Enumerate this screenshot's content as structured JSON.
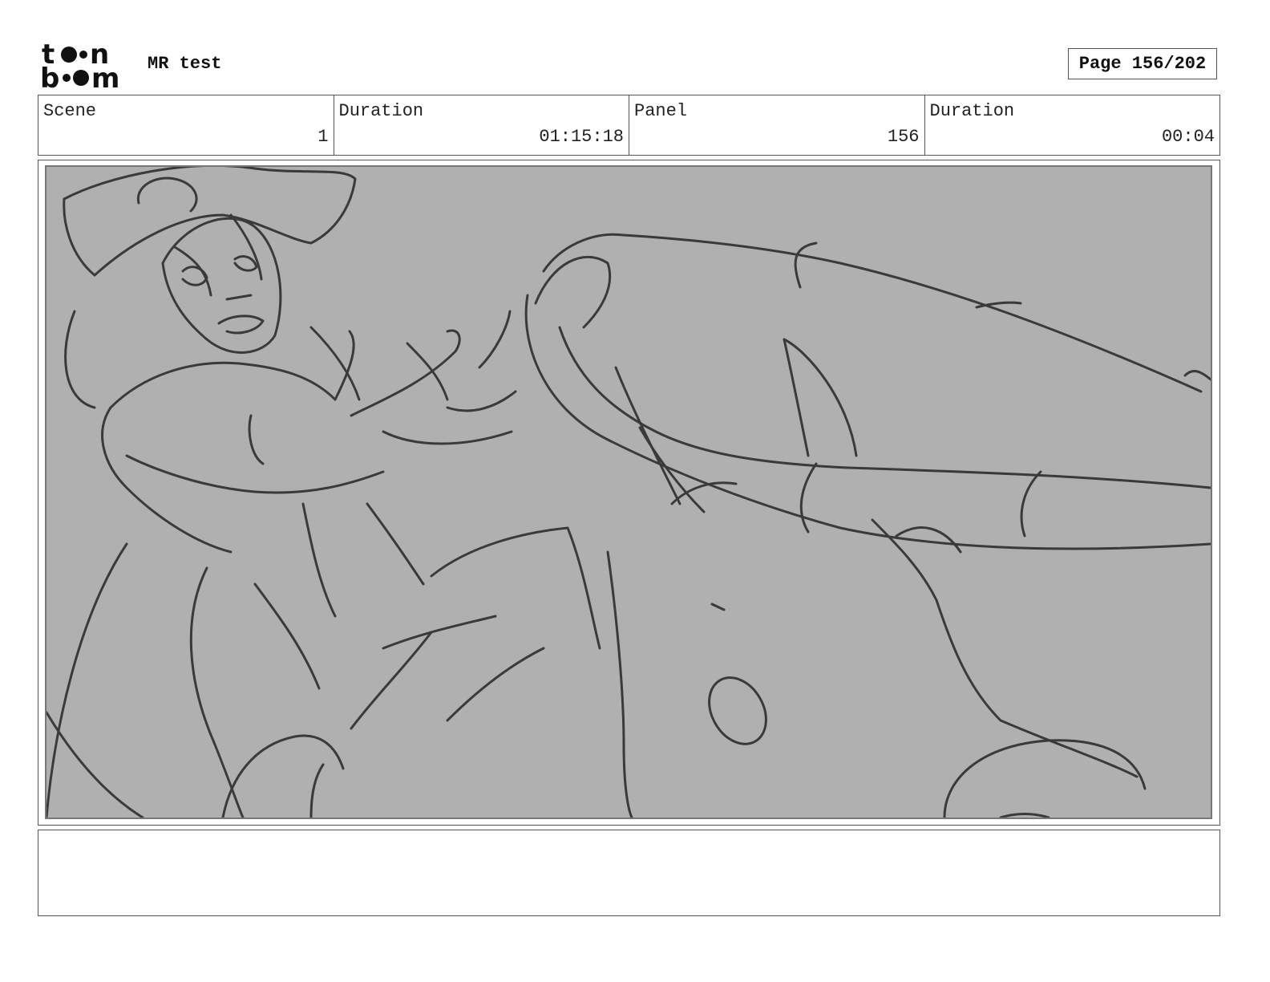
{
  "header": {
    "logo_text": "toon boom",
    "project_title": "MR test",
    "page_indicator": "Page 156/202"
  },
  "info": [
    {
      "label": "Scene",
      "value": "1"
    },
    {
      "label": "Duration",
      "value": "01:15:18"
    },
    {
      "label": "Panel",
      "value": "156"
    },
    {
      "label": "Duration",
      "value": "00:04"
    }
  ],
  "panel": {
    "image_description": "pencil sketch: character in wide-brim hat bracing against a large creature's tentacle",
    "background_color": "#b0b0b0",
    "stroke_color": "#3a3a3a"
  },
  "notes": {
    "text": ""
  }
}
